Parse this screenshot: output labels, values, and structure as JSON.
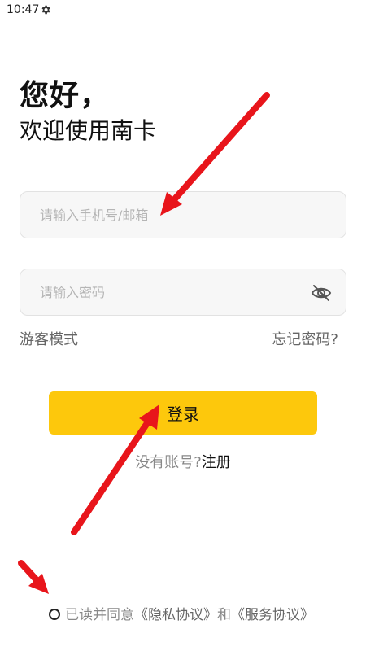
{
  "status_bar": {
    "time": "10:47",
    "settings_icon": "gear-icon"
  },
  "header": {
    "greeting": "您好，",
    "welcome": "欢迎使用南卡"
  },
  "login_form": {
    "account_placeholder": "请输入手机号/邮箱",
    "password_placeholder": "请输入密码",
    "password_visibility_icon": "eye-off-icon",
    "guest_mode": "游客模式",
    "forgot_password": "忘记密码?",
    "login_button": "登录",
    "register_prompt": "没有账号?",
    "register_link": "注册"
  },
  "agreement": {
    "prefix": "已读并同意",
    "privacy_link": "《隐私协议》",
    "conjunction": "和",
    "service_link": "《服务协议》"
  },
  "colors": {
    "accent": "#fdc80c",
    "annotation_arrow": "#e8151b"
  }
}
